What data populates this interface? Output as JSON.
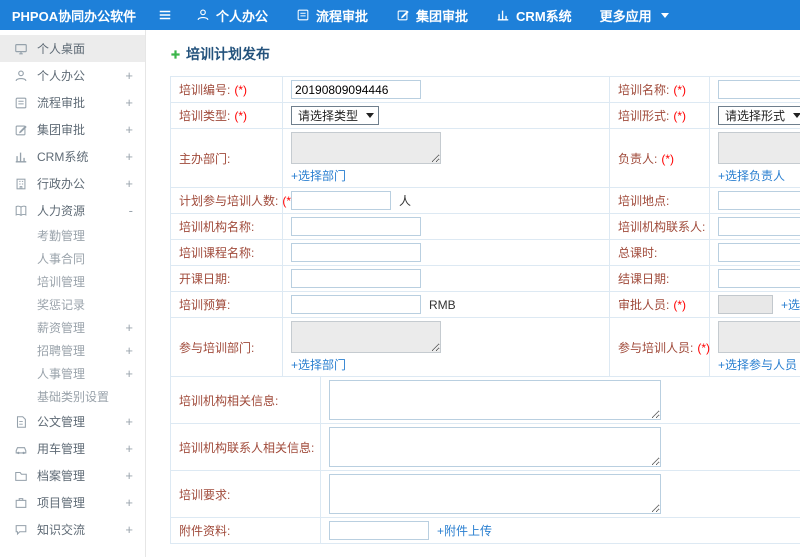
{
  "app": {
    "title": "PHPOA协同办公软件"
  },
  "topnav": {
    "items": [
      {
        "label": "个人办公"
      },
      {
        "label": "流程审批"
      },
      {
        "label": "集团审批"
      },
      {
        "label": "CRM系统"
      },
      {
        "label": "更多应用"
      }
    ]
  },
  "sidebar": {
    "top_items": [
      {
        "label": "个人桌面",
        "toggle": ""
      },
      {
        "label": "个人办公",
        "toggle": "+"
      },
      {
        "label": "流程审批",
        "toggle": "+"
      },
      {
        "label": "集团审批",
        "toggle": "+"
      },
      {
        "label": "CRM系统",
        "toggle": "+"
      },
      {
        "label": "行政办公",
        "toggle": "+"
      },
      {
        "label": "人力资源",
        "toggle": "-"
      }
    ],
    "hr_children": [
      {
        "label": "考勤管理",
        "toggle": ""
      },
      {
        "label": "人事合同",
        "toggle": ""
      },
      {
        "label": "培训管理",
        "toggle": ""
      },
      {
        "label": "奖惩记录",
        "toggle": ""
      },
      {
        "label": "薪资管理",
        "toggle": "+"
      },
      {
        "label": "招聘管理",
        "toggle": "+"
      },
      {
        "label": "人事管理",
        "toggle": "+"
      },
      {
        "label": "基础类别设置",
        "toggle": ""
      }
    ],
    "bottom_items": [
      {
        "label": "公文管理",
        "toggle": "+"
      },
      {
        "label": "用车管理",
        "toggle": "+"
      },
      {
        "label": "档案管理",
        "toggle": "+"
      },
      {
        "label": "项目管理",
        "toggle": "+"
      },
      {
        "label": "知识交流",
        "toggle": "+"
      }
    ]
  },
  "page": {
    "title": "培训计划发布"
  },
  "form": {
    "training_number": {
      "label": "培训编号:",
      "req": "(*)",
      "value": "20190809094446"
    },
    "training_name": {
      "label": "培训名称:",
      "req": "(*)"
    },
    "training_type": {
      "label": "培训类型:",
      "req": "(*)",
      "selected": "请选择类型"
    },
    "training_form": {
      "label": "培训形式:",
      "req": "(*)",
      "selected": "请选择形式"
    },
    "host_department": {
      "label": "主办部门:",
      "link": "+选择部门"
    },
    "leader": {
      "label": "负责人:",
      "req": "(*)",
      "link": "+选择负责人"
    },
    "participant_count": {
      "label": "计划参与培训人数:",
      "req": "(*)",
      "suffix": "人"
    },
    "location": {
      "label": "培训地点:"
    },
    "institution_name": {
      "label": "培训机构名称:"
    },
    "institution_contact": {
      "label": "培训机构联系人:"
    },
    "course_name": {
      "label": "培训课程名称:"
    },
    "total_hours": {
      "label": "总课时:"
    },
    "start_date": {
      "label": "开课日期:"
    },
    "end_date": {
      "label": "结课日期:"
    },
    "budget": {
      "label": "培训预算:",
      "suffix": "RMB"
    },
    "approver": {
      "label": "审批人员:",
      "req": "(*)",
      "link": "+选择审批人员"
    },
    "participating_departments": {
      "label": "参与培训部门:",
      "link": "+选择部门"
    },
    "participating_personnel": {
      "label": "参与培训人员:",
      "req": "(*)",
      "link": "+选择参与人员"
    },
    "institution_info": {
      "label": "培训机构相关信息:"
    },
    "institution_contact_info": {
      "label": "培训机构联系人相关信息:"
    },
    "requirements": {
      "label": "培训要求:"
    },
    "attachment": {
      "label": "附件资料:",
      "link": "+附件上传"
    }
  },
  "colors": {
    "topbar": "#1e80d9",
    "link": "#2a7fd0",
    "required": "#ff0000",
    "title": "#23527c",
    "plus_icon": "#3bb54a",
    "label": "#a04a3a"
  }
}
